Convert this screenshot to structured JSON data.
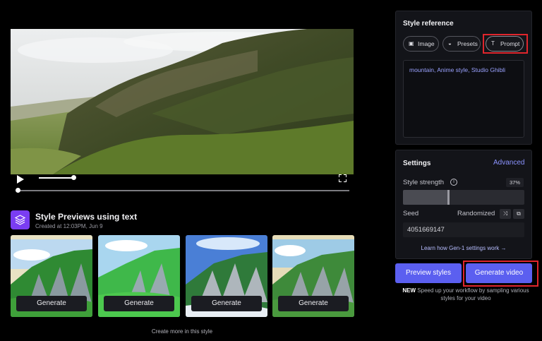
{
  "video": {
    "scene": "mountain-landscape",
    "volume": 0.85,
    "progress": 0.0
  },
  "previews": {
    "title": "Style Previews using text",
    "created": "Created at 12:03PM, Jun 9",
    "items": [
      {
        "label": "Generate"
      },
      {
        "label": "Generate"
      },
      {
        "label": "Generate"
      },
      {
        "label": "Generate"
      }
    ],
    "create_more": "Create more in this style"
  },
  "style_reference": {
    "title": "Style reference",
    "tabs": [
      {
        "label": "Image",
        "icon": "image-icon"
      },
      {
        "label": "Presets",
        "icon": "drop-icon"
      },
      {
        "label": "Prompt",
        "icon": "text-icon",
        "selected": true
      }
    ],
    "prompt_text": "mountain, Anime style, Studio Ghibli"
  },
  "settings": {
    "title": "Settings",
    "advanced_label": "Advanced",
    "style_strength_label": "Style strength",
    "style_strength_value": "37%",
    "style_strength_fraction": 0.37,
    "seed_label": "Seed",
    "randomized_label": "Randomized",
    "seed_value": "4051669147",
    "learn_link": "Learn how Gen-1 settings work →"
  },
  "actions": {
    "preview_label": "Preview styles",
    "generate_label": "Generate video",
    "note_badge": "NEW",
    "note_text": "Speed up your workflow by sampling various styles for your video"
  },
  "colors": {
    "accent": "#5b5ff0",
    "link": "#8b93ff",
    "highlight": "#e0252c",
    "preview_icon_bg": "#7a3df2"
  }
}
